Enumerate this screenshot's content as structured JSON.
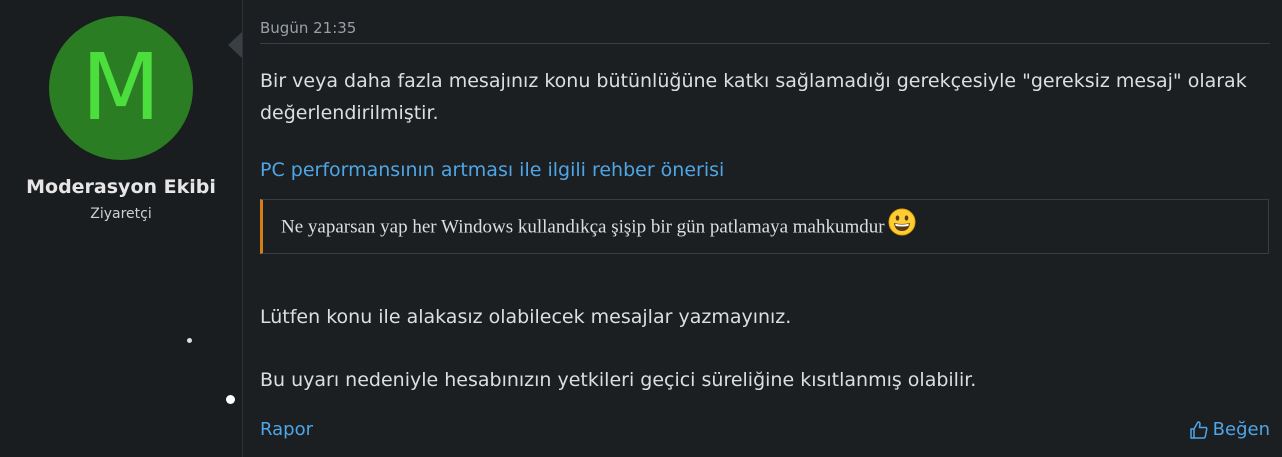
{
  "user": {
    "avatar_letter": "M",
    "name": "Moderasyon Ekibi",
    "title": "Ziyaretçi"
  },
  "post": {
    "date": "Bugün 21:35",
    "message_1": "Bir veya daha fazla mesajınız konu bütünlüğüne katkı sağlamadığı gerekçesiyle \"gereksiz mesaj\" olarak değerlendirilmiştir.",
    "thread_link": "PC performansının artması ile ilgili rehber önerisi",
    "quote_text": "Ne yaparsan yap her Windows kullandıkça şişip bir gün patlamaya mahkumdur",
    "quote_emoji": "grinning-face-emoji",
    "message_2": "Lütfen konu ile alakasız olabilecek mesajlar yazmayınız.",
    "message_3": "Bu uyarı nedeniyle hesabınızın yetkileri geçici süreliğine kısıtlanmış olabilir."
  },
  "actions": {
    "report_label": "Rapor",
    "like_label": "Beğen",
    "like_icon": "thumbs-up-icon"
  },
  "colors": {
    "background": "#1c1f22",
    "avatar_bg": "#2b7d23",
    "avatar_fg": "#4cde3c",
    "link": "#4ea6e6",
    "quote_accent": "#d47d1a"
  }
}
